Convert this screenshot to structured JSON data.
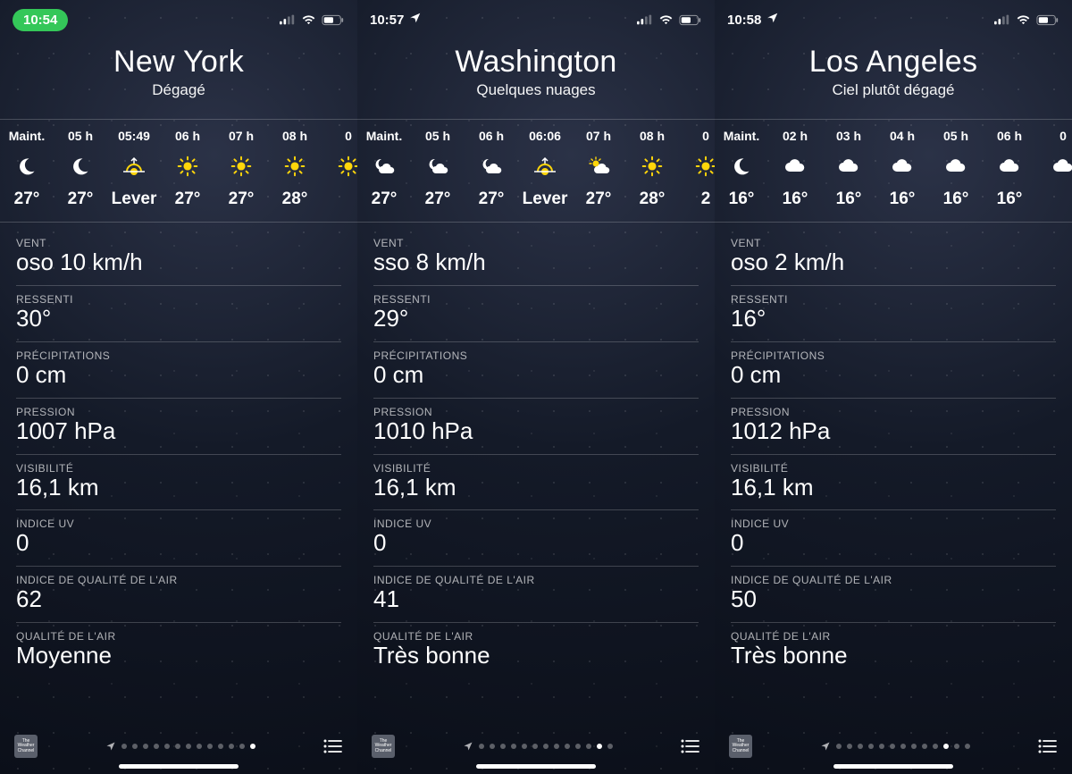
{
  "labels": {
    "vent": "VENT",
    "ressenti": "RESSENTI",
    "precip": "PRÉCIPITATIONS",
    "pression": "PRESSION",
    "visib": "VISIBILITÉ",
    "uv": "INDICE UV",
    "aqi": "INDICE DE QUALITÉ DE L'AIR",
    "airq": "QUALITÉ DE L'AIR",
    "twc": "The Weather Channel"
  },
  "screens": [
    {
      "time": "10:54",
      "time_style": "pill",
      "show_location_arrow": false,
      "city": "New York",
      "condition": "Dégagé",
      "hourly": [
        {
          "label": "Maint.",
          "icon": "moon",
          "temp": "27°",
          "now": true
        },
        {
          "label": "05 h",
          "icon": "moon",
          "temp": "27°"
        },
        {
          "label": "05:49",
          "icon": "sunrise",
          "temp": "Lever"
        },
        {
          "label": "06 h",
          "icon": "sun",
          "temp": "27°"
        },
        {
          "label": "07 h",
          "icon": "sun",
          "temp": "27°"
        },
        {
          "label": "08 h",
          "icon": "sun",
          "temp": "28°"
        },
        {
          "label": "0",
          "icon": "sun",
          "temp": ""
        }
      ],
      "details": {
        "vent": "oso 10 km/h",
        "ressenti": "30°",
        "precip": "0 cm",
        "pression": "1007 hPa",
        "visib": "16,1 km",
        "uv": "0",
        "aqi": "62",
        "airq": "Moyenne"
      },
      "page_count": 13,
      "active_page": 12
    },
    {
      "time": "10:57",
      "time_style": "plain",
      "show_location_arrow": true,
      "city": "Washington",
      "condition": "Quelques nuages",
      "hourly": [
        {
          "label": "Maint.",
          "icon": "partly-night",
          "temp": "27°",
          "now": true
        },
        {
          "label": "05 h",
          "icon": "partly-night",
          "temp": "27°"
        },
        {
          "label": "06 h",
          "icon": "partly-night",
          "temp": "27°"
        },
        {
          "label": "06:06",
          "icon": "sunrise",
          "temp": "Lever"
        },
        {
          "label": "07 h",
          "icon": "partly-day",
          "temp": "27°"
        },
        {
          "label": "08 h",
          "icon": "sun",
          "temp": "28°"
        },
        {
          "label": "0",
          "icon": "sun",
          "temp": "2"
        }
      ],
      "details": {
        "vent": "sso 8 km/h",
        "ressenti": "29°",
        "precip": "0 cm",
        "pression": "1010 hPa",
        "visib": "16,1 km",
        "uv": "0",
        "aqi": "41",
        "airq": "Très bonne"
      },
      "page_count": 13,
      "active_page": 11
    },
    {
      "time": "10:58",
      "time_style": "plain",
      "show_location_arrow": true,
      "city": "Los Angeles",
      "condition": "Ciel plutôt dégagé",
      "hourly": [
        {
          "label": "Maint.",
          "icon": "moon",
          "temp": "16°",
          "now": true
        },
        {
          "label": "02 h",
          "icon": "cloud",
          "temp": "16°"
        },
        {
          "label": "03 h",
          "icon": "cloud",
          "temp": "16°"
        },
        {
          "label": "04 h",
          "icon": "cloud",
          "temp": "16°"
        },
        {
          "label": "05 h",
          "icon": "cloud",
          "temp": "16°"
        },
        {
          "label": "06 h",
          "icon": "cloud",
          "temp": "16°"
        },
        {
          "label": "0",
          "icon": "cloud",
          "temp": ""
        }
      ],
      "details": {
        "vent": "oso 2 km/h",
        "ressenti": "16°",
        "precip": "0 cm",
        "pression": "1012 hPa",
        "visib": "16,1 km",
        "uv": "0",
        "aqi": "50",
        "airq": "Très bonne"
      },
      "page_count": 13,
      "active_page": 10
    }
  ]
}
